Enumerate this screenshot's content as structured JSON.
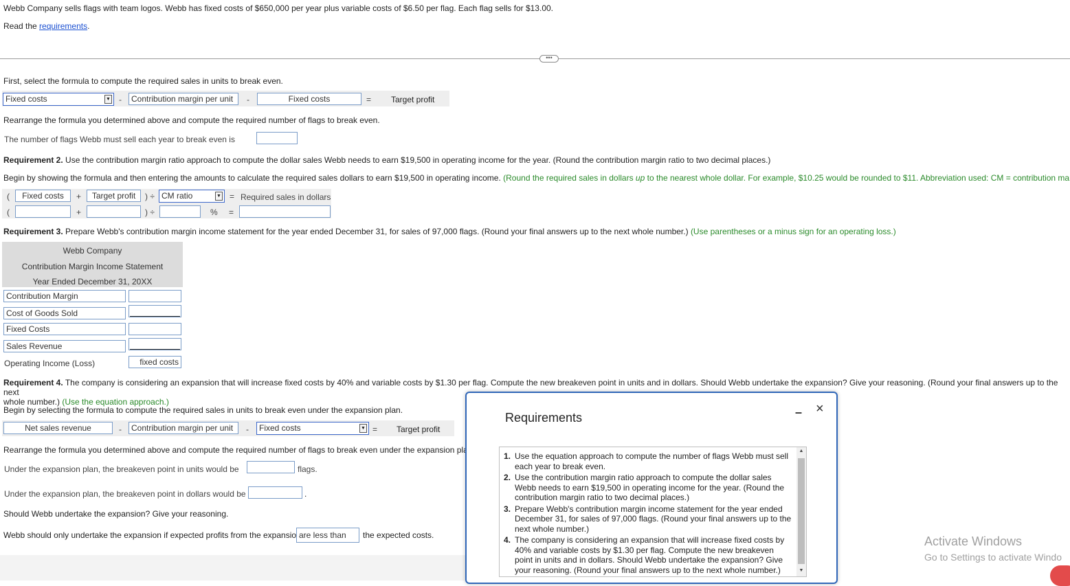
{
  "intro": {
    "problem": "Webb Company sells flags with team logos. Webb has fixed costs of $650,000 per year plus variable costs of $6.50 per flag. Each flag sells for $13.00.",
    "read_prefix": "Read the ",
    "read_link": "requirements",
    "read_suffix": "."
  },
  "req1": {
    "instruction": "First, select the formula to compute the required sales in units to break even.",
    "formula": {
      "sel1": "Fixed costs",
      "op1": "-",
      "box2": "Contribution margin per unit",
      "op2": "-",
      "box3": "Fixed costs",
      "op3": "=",
      "result": "Target profit"
    },
    "rearrange": "Rearrange the formula you determined above and compute the required number of flags to break even.",
    "answer_label": "The number of flags Webb must sell each year to break even is",
    "answer_value": ""
  },
  "req2": {
    "title_bold": "Requirement 2.",
    "title_rest": " Use the contribution margin ratio approach to compute the dollar sales Webb needs to earn $19,500 in operating income for the year. (Round the contribution margin ratio to two decimal places.)",
    "begin": "Begin by showing the formula and then entering the amounts to calculate the required sales dollars to earn $19,500 in operating income.",
    "begin_green_1": "(Round the required sales in dollars ",
    "begin_green_italic": "up",
    "begin_green_2": " to the nearest whole dollar. For example, $10.25 would be rounded to $11. Abbreviation used: CM = contribution margin.)",
    "row1": {
      "paren_open": "(",
      "box1": "Fixed costs",
      "plus": "+",
      "box2": "Target profit",
      "close_div": ") ÷",
      "sel": "CM ratio",
      "eq": "=",
      "result": "Required sales in dollars"
    },
    "row2": {
      "paren_open": "(",
      "plus": "+",
      "close_div": ") ÷",
      "pct": "%",
      "eq": "="
    }
  },
  "req3": {
    "title_bold": "Requirement 3.",
    "title_rest": " Prepare Webb's contribution margin income statement for the year ended December 31, for sales of 97,000 flags. (Round your final answers up to the next whole number.) ",
    "title_green": "(Use parentheses or a minus sign for an operating loss.)",
    "statement": {
      "company": "Webb Company",
      "name": "Contribution Margin Income Statement",
      "period": "Year Ended December 31, 20XX",
      "rows": [
        {
          "label": "Contribution Margin",
          "value": ""
        },
        {
          "label": "Cost of Goods Sold",
          "value": ""
        },
        {
          "label": "Fixed Costs",
          "value": ""
        },
        {
          "label": "Sales Revenue",
          "value": ""
        }
      ],
      "total_label": "Operating Income (Loss)",
      "total_value": "fixed costs"
    }
  },
  "req4": {
    "title_bold": "Requirement 4.",
    "title_rest": " The company is considering an expansion that will increase fixed costs by 40% and variable costs by $1.30 per flag. Compute the new breakeven point in units and in dollars. Should Webb undertake the expansion? Give your reasoning. (Round your final answers up to the next",
    "title_line2": "whole number.) ",
    "title_green": "(Use the equation approach.)",
    "begin": "Begin by selecting the formula to compute the required sales in units to break even under the expansion plan.",
    "formula": {
      "box1": "Net sales revenue",
      "op1": "-",
      "box2": "Contribution margin per unit",
      "op2": "-",
      "sel": "Fixed costs",
      "op3": "=",
      "result": "Target profit"
    },
    "rearrange": "Rearrange the formula you determined above and compute the required number of flags to break even under the expansion plan.",
    "units_label": "Under the expansion plan, the breakeven point in units would be",
    "units_suffix": "flags.",
    "dollars_label": "Under the expansion plan, the breakeven point in dollars would be",
    "dollars_suffix": ".",
    "should_q": "Should Webb undertake the expansion? Give your reasoning.",
    "reason_prefix": "Webb should only undertake the expansion if expected profits from the expansion",
    "reason_choice": "are less than",
    "reason_suffix": "the expected costs."
  },
  "modal": {
    "title": "Requirements",
    "minimize": "–",
    "close": "×",
    "items": [
      {
        "num": "1.",
        "text": "Use the equation approach to compute the number of flags Webb must sell each year to break even."
      },
      {
        "num": "2.",
        "text": "Use the contribution margin ratio approach to compute the dollar sales Webb needs to earn $19,500 in operating income for the year. (Round the contribution margin ratio to two decimal places.)"
      },
      {
        "num": "3.",
        "text": "Prepare Webb's contribution margin income statement for the year ended December 31, for sales of 97,000 flags. (Round your final answers up to the next whole number.)"
      },
      {
        "num": "4.",
        "text": "The company is considering an expansion that will increase fixed costs by 40% and variable costs by $1.30 per flag. Compute the new breakeven point in units and in dollars. Should Webb undertake the expansion? Give your reasoning. (Round your final answers up to the next whole number.)"
      }
    ]
  },
  "separator_dots": "•••",
  "windows": {
    "activate": "Activate Windows",
    "goto": "Go to Settings to activate Windo"
  },
  "icons": {
    "dropdown": "chevron-down-icon",
    "more": "ellipsis-icon"
  }
}
